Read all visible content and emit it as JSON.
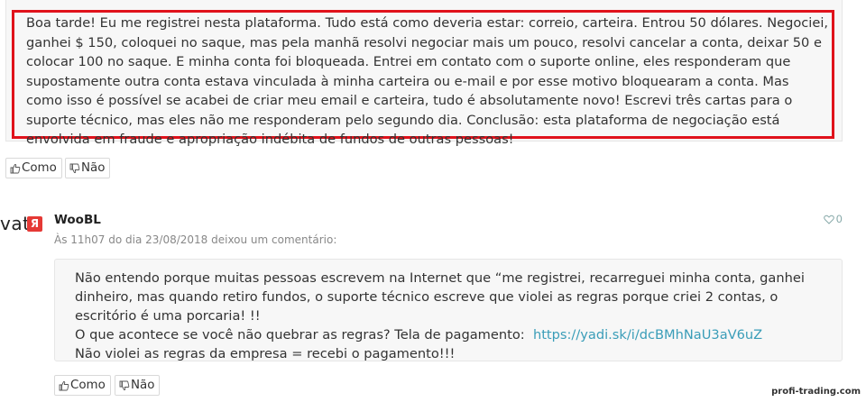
{
  "comment1": {
    "text": "Boa tarde! Eu me registrei nesta plataforma. Tudo está como deveria estar: correio, carteira. Entrou 50 dólares. Negociei, ganhei $ 150, coloquei no saque, mas pela manhã resolvi negociar mais um pouco, resolvi cancelar a conta, deixar 50 e colocar 100 no saque. E minha conta foi bloqueada. Entrei em contato com o suporte online, eles responderam que supostamente outra conta estava vinculada à minha carteira ou e-mail e por esse motivo bloquearam a conta. Mas como isso é possível se acabei de criar meu email e carteira, tudo é absolutamente novo! Escrevi três cartas para o suporte técnico, mas eles não me responderam pelo segundo dia. Conclusão: esta plataforma de negociação está envolvida em fraude e apropriação indébita de fundos de outras pessoas!",
    "like_label": "Como",
    "dislike_label": "Não",
    "highlight_color": "#e0121b"
  },
  "comment2": {
    "avatar_fragment": "vat",
    "avatar_badge": "Я",
    "author": "WooBL",
    "meta": "Às 11h07 do dia 23/08/2018 deixou um comentário:",
    "likes_count": "0",
    "paragraph1": "Não entendo porque muitas pessoas escrevem na Internet que “me registrei, recarreguei minha conta, ganhei dinheiro, mas quando retiro fundos, o suporte técnico escreve que violei as regras porque criei 2 contas, o escritório é uma porcaria! !!",
    "paragraph2_prefix": "O que acontece se você não quebrar as regras? Tela de pagamento:",
    "payment_link": "https://yadi.sk/i/dcBMhNaU3aV6uZ",
    "paragraph3": "Não violei as regras da empresa = recebi o pagamento!!!",
    "like_label": "Como",
    "dislike_label": "Não",
    "link_color": "#3a9db8"
  },
  "watermark": "profi-trading.com",
  "icons": {
    "like": "thumbs-up-icon",
    "dislike": "thumbs-down-icon",
    "heart": "heart-icon"
  }
}
